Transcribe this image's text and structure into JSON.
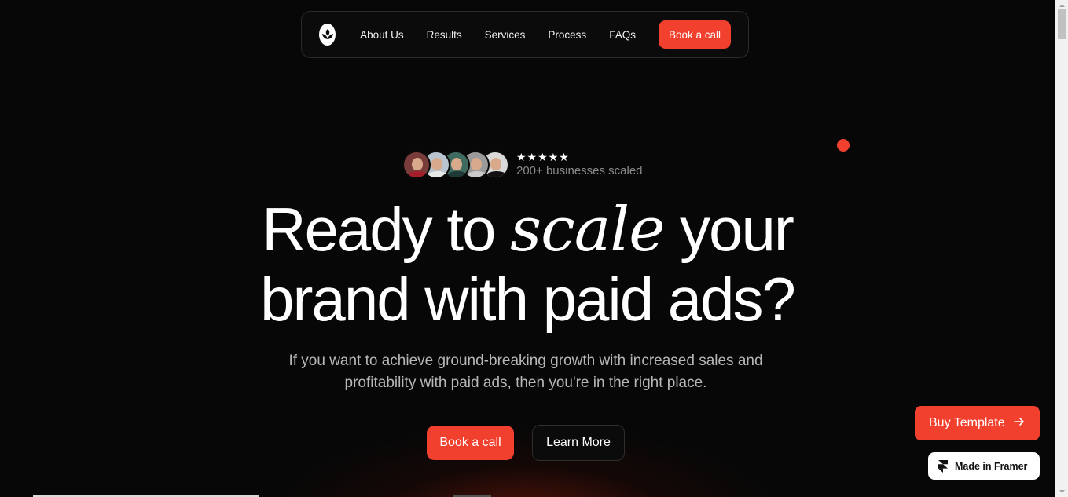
{
  "nav": {
    "logo_icon": "leaf-logo-icon",
    "links": [
      "About Us",
      "Results",
      "Services",
      "Process",
      "FAQs"
    ],
    "cta": "Book a call"
  },
  "proof": {
    "stars": "★★★★★",
    "label": "200+ businesses scaled",
    "avatars": [
      {
        "shirt": "#a51f2a",
        "bg": "#7a3b3b"
      },
      {
        "shirt": "#e8e8e8",
        "bg": "#b8c4d0"
      },
      {
        "shirt": "#1f3a36",
        "bg": "#3f6a60"
      },
      {
        "shirt": "#c9c9c9",
        "bg": "#9a9a9a"
      },
      {
        "shirt": "#111111",
        "bg": "#d9d9d9"
      }
    ]
  },
  "hero": {
    "line1_before": "Ready to ",
    "line1_italic": "scale",
    "line1_after": " your",
    "line2": "brand with paid ads?",
    "subtitle": "If you want to achieve ground-breaking growth with increased sales and profitability with paid ads, then you're in the right place.",
    "primary_cta": "Book a call",
    "secondary_cta": "Learn More"
  },
  "floating": {
    "buy_label": "Buy Template",
    "buy_icon": "arrow-right-icon",
    "framer_label": "Made in Framer",
    "framer_icon": "framer-logo-icon"
  },
  "colors": {
    "accent": "#f2402f",
    "background": "#070707"
  }
}
